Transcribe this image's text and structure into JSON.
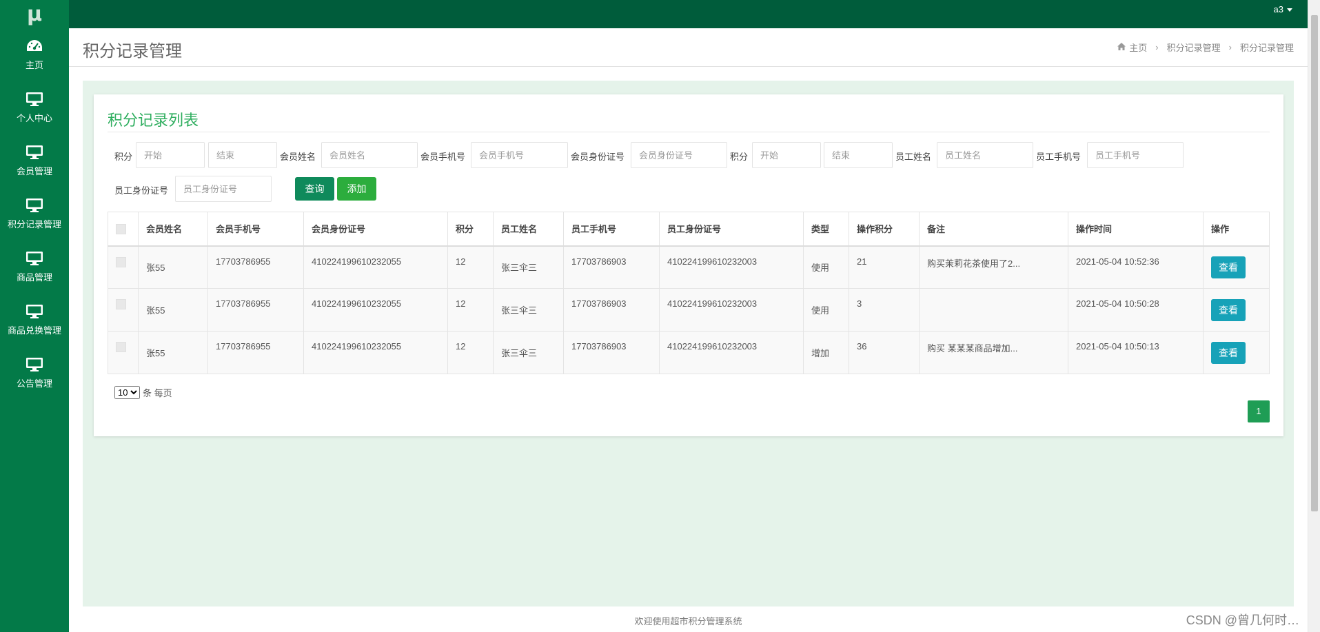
{
  "logo": "μ",
  "sidebar": {
    "items": [
      {
        "label": "主页",
        "icon": "dashboard-icon"
      },
      {
        "label": "个人中心",
        "icon": "monitor-icon"
      },
      {
        "label": "会员管理",
        "icon": "monitor-icon"
      },
      {
        "label": "积分记录管理",
        "icon": "monitor-icon"
      },
      {
        "label": "商品管理",
        "icon": "monitor-icon"
      },
      {
        "label": "商品兑换管理",
        "icon": "monitor-icon"
      },
      {
        "label": "公告管理",
        "icon": "monitor-icon"
      }
    ]
  },
  "topbar": {
    "user": "a3"
  },
  "header": {
    "title": "积分记录管理",
    "breadcrumb": [
      "主页",
      "积分记录管理",
      "积分记录管理"
    ]
  },
  "panel": {
    "title": "积分记录列表"
  },
  "filters": {
    "points_label": "积分",
    "points_start_placeholder": "开始",
    "points_end_placeholder": "结束",
    "member_name_label": "会员姓名",
    "member_name_placeholder": "会员姓名",
    "member_phone_label": "会员手机号",
    "member_phone_placeholder": "会员手机号",
    "member_id_label": "会员身份证号",
    "member_id_placeholder": "会员身份证号",
    "points2_label": "积分",
    "points2_start_placeholder": "开始",
    "points2_end_placeholder": "结束",
    "staff_name_label": "员工姓名",
    "staff_name_placeholder": "员工姓名",
    "staff_phone_label": "员工手机号",
    "staff_phone_placeholder": "员工手机号",
    "staff_id_label": "员工身份证号",
    "staff_id_placeholder": "员工身份证号",
    "query_button": "查询",
    "add_button": "添加"
  },
  "table": {
    "columns": [
      "会员姓名",
      "会员手机号",
      "会员身份证号",
      "积分",
      "员工姓名",
      "员工手机号",
      "员工身份证号",
      "类型",
      "操作积分",
      "备注",
      "操作时间",
      "操作"
    ],
    "rows": [
      {
        "member_name": "张55",
        "member_phone": "17703786955",
        "member_id": "410224199610232055",
        "points": "12",
        "staff_name": "张三伞三",
        "staff_phone": "17703786903",
        "staff_id": "410224199610232003",
        "type": "使用",
        "op_points": "21",
        "remark": "购买茉莉花茶使用了2...",
        "time": "2021-05-04 10:52:36",
        "action": "查看"
      },
      {
        "member_name": "张55",
        "member_phone": "17703786955",
        "member_id": "410224199610232055",
        "points": "12",
        "staff_name": "张三伞三",
        "staff_phone": "17703786903",
        "staff_id": "410224199610232003",
        "type": "使用",
        "op_points": "3",
        "remark": "",
        "time": "2021-05-04 10:50:28",
        "action": "查看"
      },
      {
        "member_name": "张55",
        "member_phone": "17703786955",
        "member_id": "410224199610232055",
        "points": "12",
        "staff_name": "张三伞三",
        "staff_phone": "17703786903",
        "staff_id": "410224199610232003",
        "type": "增加",
        "op_points": "36",
        "remark": "购买 某某某商品增加...",
        "time": "2021-05-04 10:50:13",
        "action": "查看"
      }
    ]
  },
  "pagination": {
    "page_size": "10",
    "page_size_suffix": "条 每页",
    "current_page": "1"
  },
  "footer": {
    "text": "欢迎使用超市积分管理系统"
  },
  "watermark": "CSDN @曾几何时…",
  "colors": {
    "sidebar": "#037a48",
    "topbar": "#005c3b",
    "accent": "#2fae5f",
    "view_button": "#17a2b8"
  }
}
